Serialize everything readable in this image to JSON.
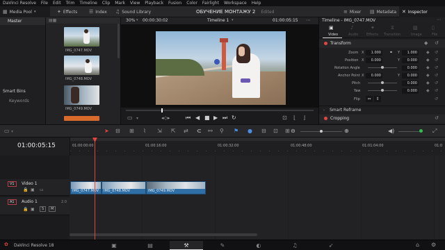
{
  "menu": [
    "DaVinci Resolve",
    "File",
    "Edit",
    "Trim",
    "Timeline",
    "Clip",
    "Mark",
    "View",
    "Playback",
    "Fusion",
    "Color",
    "Fairlight",
    "Workspace",
    "Help"
  ],
  "toolbar": {
    "media_pool": "Media Pool",
    "effects": "Effects",
    "index": "Index",
    "sound_library": "Sound Library",
    "project_title": "ОБУЧЕНИЕ МОНТАЖУ 2",
    "edited": "Edited",
    "mixer": "Mixer",
    "metadata": "Metadata",
    "inspector": "Inspector"
  },
  "left_panel": {
    "master": "Master",
    "smart_bins": "Smart Bins",
    "keywords": "Keywords"
  },
  "media_pool": {
    "clips": [
      "IMG_0747.MOV",
      "IMG_0748.MOV",
      "IMG_0749.MOV"
    ]
  },
  "viewer": {
    "zoom": "30%",
    "source_timecode": "00:00:30:02",
    "timeline_name": "Timeline 1",
    "record_timecode": "01:00:05:15"
  },
  "inspector": {
    "title": "Timeline - IMG_0747.MOV",
    "tabs": [
      "Video",
      "Audio",
      "Effects",
      "Transition",
      "Image",
      "File"
    ],
    "transform_label": "Transform",
    "zoom_label": "Zoom",
    "zoom_x": "1.000",
    "zoom_y": "1.000",
    "position_label": "Position",
    "position_x": "0.000",
    "position_y": "0.000",
    "rotation_label": "Rotation Angle",
    "rotation": "0.000",
    "anchor_label": "Anchor Point",
    "anchor_x": "0.000",
    "anchor_y": "0.000",
    "pitch_label": "Pitch",
    "pitch": "0.000",
    "yaw_label": "Yaw",
    "yaw": "0.000",
    "flip_label": "Flip",
    "smart_reframe": "Smart Reframe",
    "cropping": "Cropping",
    "x": "X",
    "y": "Y"
  },
  "timeline": {
    "timecode": "01:00:05:15",
    "ruler": [
      "01:00:00:00",
      "01:00:16:00",
      "01:00:32:00",
      "01:00:48:00",
      "01:01:04:00",
      "01:0"
    ],
    "video_track_id": "V1",
    "video_track_name": "Video 1",
    "audio_track_id": "A1",
    "audio_track_name": "Audio 1",
    "audio_level": "2.0",
    "clips": [
      "IMG_0747.MOV",
      "IMG_0748.MOV",
      "IMG_0749.MOV"
    ]
  },
  "status": {
    "app": "DaVinci Resolve 18"
  },
  "colors": {
    "accent": "#e0473f",
    "clip": "#2f6fa6",
    "playhead": "#e0473f"
  }
}
